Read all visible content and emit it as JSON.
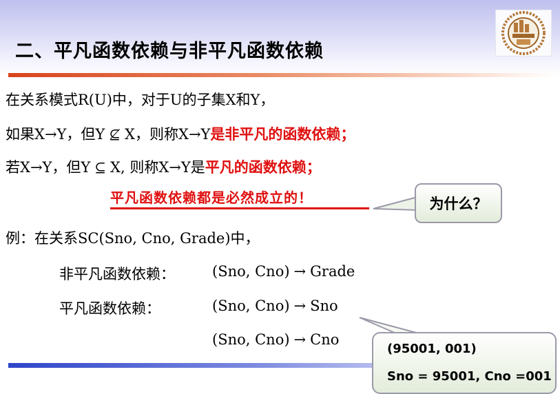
{
  "title": "二、平凡函数依赖与非平凡函数依赖",
  "lines": {
    "l1": "在关系模式R(U)中，对于U的子集X和Y，",
    "l2_prefix": "如果X→Y，但Y",
    "l2_middle": "X，则称X→Y",
    "l2_red": "是非平凡的函数依赖；",
    "l3_prefix": "若X→Y，但Y",
    "l3_middle": "X,    则称X→Y是",
    "l3_red": "平凡的函数依赖；"
  },
  "symbols": {
    "not_subset": "⊈",
    "subset": "⊆"
  },
  "emphasis": "平凡函数依赖都是必然成立的！",
  "callout_why": "为什么？",
  "example": {
    "intro": "例：在关系SC(Sno, Cno, Grade)中，",
    "nontrivial_label": "非平凡函数依赖：",
    "nontrivial_lhs": "(Sno, Cno)",
    "nontrivial_rhs": "Grade",
    "trivial_label": "平凡函数依赖：",
    "trivial_lhs": "(Sno, Cno)",
    "trivial_rhs1": "Sno",
    "trivial_lhs2": "(Sno, Cno)",
    "trivial_rhs2": "Cno",
    "arrow": "→"
  },
  "callout_example": {
    "line1": "(95001, 001)",
    "line2": "Sno = 95001, Cno =001"
  }
}
